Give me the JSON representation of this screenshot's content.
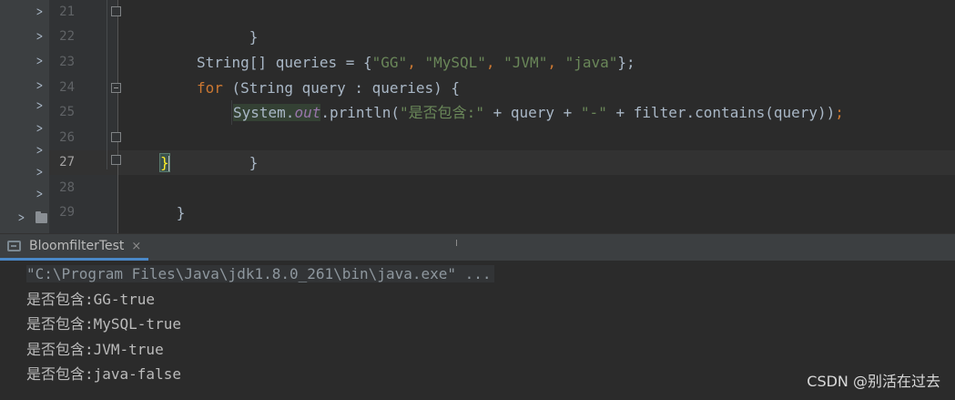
{
  "editor": {
    "line_numbers": [
      "21",
      "22",
      "23",
      "24",
      "25",
      "26",
      "27",
      "28",
      "29"
    ],
    "code": {
      "line21": "}",
      "line23": {
        "type": "String[]",
        "var_decl": " queries = {",
        "s1": "\"GG\"",
        "sep1": ", ",
        "s2": "\"MySQL\"",
        "sep2": ", ",
        "s3": "\"JVM\"",
        "sep3": ", ",
        "s4": "\"java\"",
        "end": "};"
      },
      "line24": {
        "kw": "for",
        "rest": " (String query : queries) {"
      },
      "line25": {
        "cls": "System.",
        "field": "out",
        "call": ".println(",
        "s1": "\"是否包含:\"",
        "mid1": " + query + ",
        "s2": "\"-\"",
        "mid2": " + filter.contains(query))",
        "end": ";"
      },
      "line26": "}",
      "line27": "}",
      "line28": "}"
    }
  },
  "run_panel": {
    "tab_label": "BloomfilterTest",
    "close_glyph": "×",
    "console": {
      "command": "\"C:\\Program Files\\Java\\jdk1.8.0_261\\bin\\java.exe\" ...",
      "outputs": [
        "是否包含:GG-true",
        "是否包含:MySQL-true",
        "是否包含:JVM-true",
        "是否包含:java-false"
      ]
    }
  },
  "watermark": "CSDN @别活在过去",
  "icons": {
    "chevron": "chevron-right-icon",
    "folder": "folder-icon",
    "fold": "fold-marker-icon",
    "run_tab": "console-icon",
    "close": "close-icon"
  },
  "colors": {
    "editor_bg": "#2b2b2b",
    "keyword": "#cc7832",
    "string": "#6a8759",
    "static_field": "#9876aa",
    "text": "#a9b7c6",
    "brace_match": "#ffef28",
    "tab_underline": "#4a88c7"
  }
}
